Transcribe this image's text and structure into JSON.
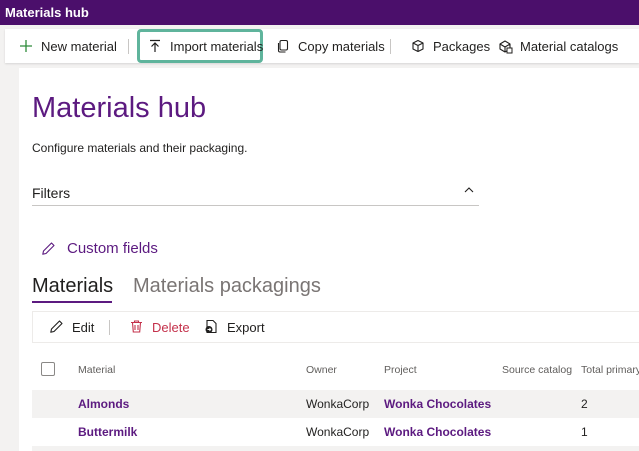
{
  "app": {
    "title": "Materials hub"
  },
  "commands": {
    "new_material": "New material",
    "import_materials": "Import materials",
    "copy_materials": "Copy materials",
    "packages": "Packages",
    "material_catalogs": "Material catalogs"
  },
  "page": {
    "title": "Materials hub",
    "subtitle": "Configure materials and their packaging.",
    "filters_label": "Filters",
    "custom_fields_label": "Custom fields"
  },
  "tabs": [
    {
      "label": "Materials",
      "active": true
    },
    {
      "label": "Materials packagings",
      "active": false
    }
  ],
  "subcommands": {
    "edit": "Edit",
    "delete": "Delete",
    "export": "Export"
  },
  "table": {
    "columns": [
      "Material",
      "Owner",
      "Project",
      "Source catalog",
      "Total primary"
    ],
    "rows": [
      {
        "material": "Almonds",
        "owner": "WonkaCorp",
        "project": "Wonka Chocolates",
        "source_catalog": "",
        "total_primary": "2"
      },
      {
        "material": "Buttermilk",
        "owner": "WonkaCorp",
        "project": "Wonka Chocolates",
        "source_catalog": "",
        "total_primary": "1"
      }
    ]
  },
  "colors": {
    "titlebar": "#4b0f6b",
    "accent": "#5c1a80",
    "highlight": "#5fb49c",
    "delete": "#c4314b"
  },
  "icons": [
    "plus-icon",
    "upload-icon",
    "copy-icon",
    "package-icon",
    "catalog-icon",
    "chevron-up-icon",
    "pencil-icon",
    "trash-icon",
    "export-icon"
  ]
}
